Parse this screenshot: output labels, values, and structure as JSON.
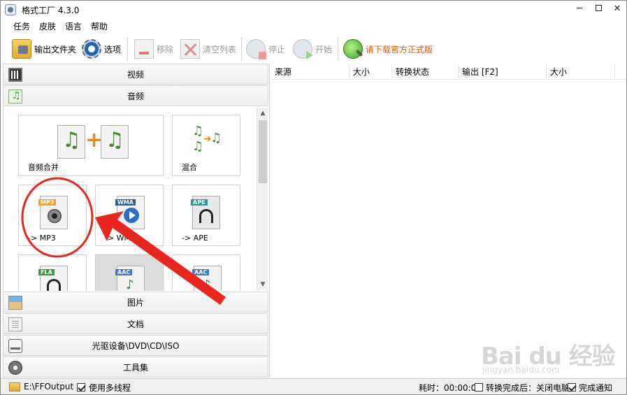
{
  "window": {
    "title": "格式工厂 4.3.0"
  },
  "menu": [
    "任务",
    "皮肤",
    "语言",
    "帮助"
  ],
  "toolbar": {
    "output_folder": "输出文件夹",
    "options": "选项",
    "remove": "移除",
    "clear_list": "清空列表",
    "stop": "停止",
    "start": "开始",
    "download": "请下载官方正式版"
  },
  "categories": {
    "video": "视频",
    "audio": "音频",
    "image": "图片",
    "document": "文档",
    "disc": "光驱设备\\DVD\\CD\\ISO",
    "tools": "工具集"
  },
  "audio_tiles": {
    "merge": {
      "label": "音频合并"
    },
    "mix": {
      "label": "混合"
    },
    "mp3": {
      "label": "-> MP3",
      "badge": "MP3",
      "badge_color": "#f0a020"
    },
    "wma": {
      "label": "-> WMA",
      "badge": "WMA",
      "badge_color": "#2a5f9e"
    },
    "ape": {
      "label": "-> APE",
      "badge": "APE",
      "badge_color": "#2a9a9a"
    },
    "fla": {
      "badge": "FLA",
      "badge_color": "#3a9a3a"
    },
    "aac1": {
      "badge": "AAC",
      "badge_color": "#3a7ad0"
    },
    "aac2": {
      "badge": "AAC",
      "badge_color": "#3a7ad0"
    }
  },
  "task_list": {
    "columns": [
      "来源",
      "大小",
      "转换状态",
      "输出 [F2]",
      "大小"
    ]
  },
  "status": {
    "output_path": "E:\\FFOutput",
    "multithread": "使用多线程",
    "multithread_checked": true,
    "elapsed": "耗时：00:00:00",
    "after_done": "转换完成后：关闭电脑",
    "after_done_checked": false,
    "notify": "完成通知",
    "notify_checked": true
  },
  "watermark": {
    "logo": "Bai du 经验",
    "url": "jingyan.baidu.com"
  },
  "annotation_color": "#e8261d"
}
